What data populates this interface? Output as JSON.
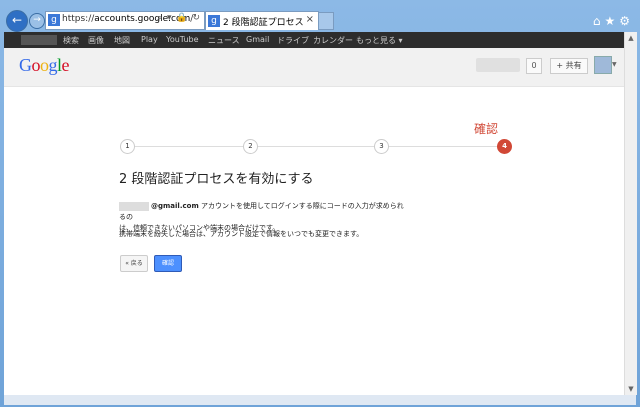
{
  "browser": {
    "url_prefix": "https://",
    "url_domain": "accounts.google.com",
    "url_suffix": "/",
    "tab_title": "2 段階認証プロセス",
    "tab_close": "×",
    "address_icons": "⌕ ▾ 🔒 ↻"
  },
  "gbar": {
    "items": [
      "検索",
      "画像",
      "地図",
      "Play",
      "YouTube",
      "ニュース",
      "Gmail",
      "ドライブ",
      "カレンダー",
      "もっと見る ▾"
    ]
  },
  "header": {
    "logo_letters": [
      {
        "ch": "G",
        "color": "#3369e8"
      },
      {
        "ch": "o",
        "color": "#d50f25"
      },
      {
        "ch": "o",
        "color": "#eeb211"
      },
      {
        "ch": "g",
        "color": "#3369e8"
      },
      {
        "ch": "l",
        "color": "#009925"
      },
      {
        "ch": "e",
        "color": "#d50f25"
      }
    ],
    "notification_count": "0",
    "share_label": "+ 共有"
  },
  "stepper": {
    "steps": [
      "1",
      "2",
      "3",
      "4"
    ],
    "current_label": "確認"
  },
  "main": {
    "heading": "2 段階認証プロセスを有効にする",
    "email_domain": "@gmail.com",
    "desc_line1": " アカウントを使用してログインする際にコードの入力が求められるの",
    "desc_line2": "は、信頼できないパソコンや端末の場合だけです。",
    "desc2": "携帯端末を紛失した場合は、アカウント設定で情報をいつでも変更できます。",
    "back_button": "« 戻る",
    "confirm_button": "確認"
  },
  "colors": {
    "accent_red": "#d14836",
    "button_blue": "#4d90fe",
    "gbar_bg": "#2d2d2d"
  }
}
